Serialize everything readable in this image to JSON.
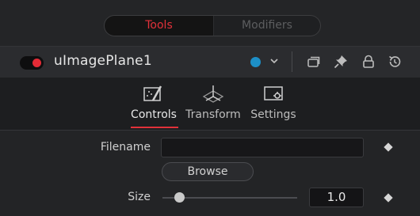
{
  "segmented": {
    "tools_label": "Tools",
    "modifiers_label": "Modifiers",
    "active": "Tools"
  },
  "header": {
    "node_name": "uImagePlane1",
    "enabled": true,
    "color_accent": "#e42b36",
    "color_tag": "#1d8fc7",
    "icons": [
      "color-dot-icon",
      "chevron-down-icon",
      "tabs-icon",
      "pin-icon",
      "lock-icon",
      "reset-icon"
    ]
  },
  "tabs": [
    {
      "label": "Controls",
      "icon": "controls-icon",
      "active": true
    },
    {
      "label": "Transform",
      "icon": "transform-icon",
      "active": false
    },
    {
      "label": "Settings",
      "icon": "settings-icon",
      "active": false
    }
  ],
  "controls": {
    "filename_label": "Filename",
    "filename_value": "",
    "browse_label": "Browse",
    "size_label": "Size",
    "size_value": "1.0",
    "size_slider_fraction": 0.1
  }
}
